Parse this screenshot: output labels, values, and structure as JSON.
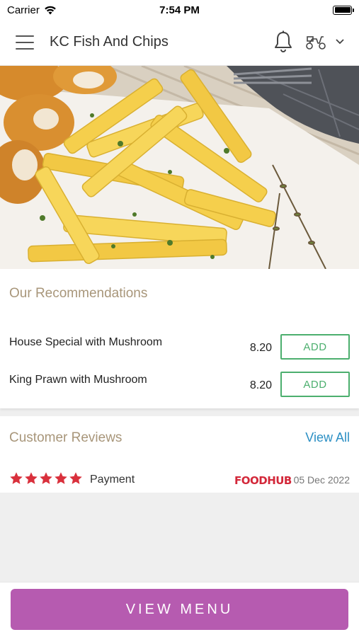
{
  "status_bar": {
    "carrier": "Carrier",
    "time": "7:54 PM",
    "icons": [
      "wifi-icon",
      "battery-icon"
    ]
  },
  "header": {
    "title": "KC Fish And Chips",
    "icons": [
      "hamburger-menu-icon",
      "bell-icon",
      "scooter-icon",
      "chevron-down-icon"
    ]
  },
  "hero": {
    "image_description_icon": "fish-and-chips-photo"
  },
  "recommendations": {
    "title": "Our Recommendations",
    "items": [
      {
        "name": "House Special with Mushroom",
        "price": "8.20",
        "button": "ADD"
      },
      {
        "name": "King Prawn with Mushroom",
        "price": "8.20",
        "button": "ADD"
      }
    ]
  },
  "reviews": {
    "title": "Customer Reviews",
    "view_all": "View All",
    "latest": {
      "rating": 5,
      "text": "Payment",
      "source": "FOODHUB",
      "date": "05 Dec 2022"
    }
  },
  "bottom": {
    "button": "VIEW MENU"
  },
  "colors": {
    "accent_purple": "#b65bb0",
    "add_green": "#4caf6e",
    "section_title": "#a8967a",
    "link_blue": "#2b8fc4",
    "star_red": "#d9303c"
  }
}
